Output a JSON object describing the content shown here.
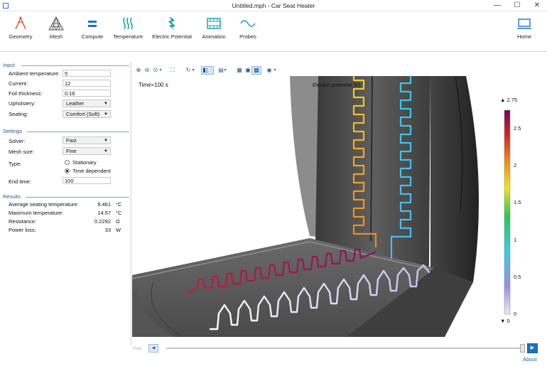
{
  "window": {
    "title": "Untitled.mph - Car Seat Heater",
    "minimize": "—",
    "maximize": "☐",
    "close": "✕"
  },
  "ribbon": {
    "buttons": [
      {
        "label": "Geometry",
        "icon": "geometry-icon"
      },
      {
        "label": "Mesh",
        "icon": "mesh-icon"
      },
      {
        "label": "Compute",
        "icon": "compute-icon"
      },
      {
        "label": "Temperature",
        "icon": "temperature-icon"
      },
      {
        "label": "Electric Potential",
        "icon": "electric-potential-icon"
      },
      {
        "label": "Animation",
        "icon": "animation-icon"
      },
      {
        "label": "Probes",
        "icon": "probes-icon"
      },
      {
        "label": "Home",
        "icon": "home-icon"
      }
    ]
  },
  "input": {
    "header": "Input",
    "ambient_label": "Ambient temperature:",
    "ambient_value": "5",
    "current_label": "Current:",
    "current_value": "12",
    "foil_label": "Foil thickness:",
    "foil_value": "0.16",
    "upholstery_label": "Upholstery:",
    "upholstery_value": "Leather",
    "seating_label": "Seating:",
    "seating_value": "Comfort (Soft)"
  },
  "settings": {
    "header": "Settings",
    "solver_label": "Solver:",
    "solver_value": "Fast",
    "mesh_label": "Mesh size:",
    "mesh_value": "Fine",
    "type_label": "Type:",
    "type_option1": "Stationary",
    "type_option2": "Time dependent",
    "type_selected": "Time dependent",
    "endtime_label": "End time:",
    "endtime_value": "100"
  },
  "results": {
    "header": "Results",
    "rows": [
      {
        "label": "Average seating temperature:",
        "value": "9.461",
        "unit": "°C"
      },
      {
        "label": "Maximum temperature:",
        "value": "14.57",
        "unit": "°C"
      },
      {
        "label": "Resistance:",
        "value": "0.2292",
        "unit": "Ω"
      },
      {
        "label": "Power loss:",
        "value": "33",
        "unit": "W"
      }
    ]
  },
  "graphics": {
    "time_label": "Time=100 s",
    "plot_title": "Electric potential (V)",
    "colorbar": {
      "max_label": "▲ 2.75",
      "min_label": "▼ 0",
      "ticks": [
        "2.5",
        "2",
        "1.5",
        "1",
        "0.5",
        "0"
      ],
      "tick_values": [
        2.5,
        2,
        1.5,
        1,
        0.5,
        0
      ],
      "range": [
        0,
        2.75
      ],
      "colors": [
        "#f0e6f0",
        "#9a8ce0",
        "#3ec9e8",
        "#27c85a",
        "#f2e21a",
        "#ef8a1a",
        "#d52424",
        "#6a0c5a"
      ]
    },
    "heater_colors": {
      "back_left": [
        "#f7d31c",
        "#f2a81d",
        "#f08a1c"
      ],
      "back_right": [
        "#34c8e6",
        "#56b6ec"
      ],
      "seat_back": [
        "#c41a3c",
        "#8a1060"
      ],
      "seat_front": [
        "#ffffff",
        "#c8bff2"
      ]
    }
  },
  "bottom": {
    "play_label": "Play",
    "prev_icon": "◀",
    "next_icon": "▶",
    "about_label": "About"
  }
}
